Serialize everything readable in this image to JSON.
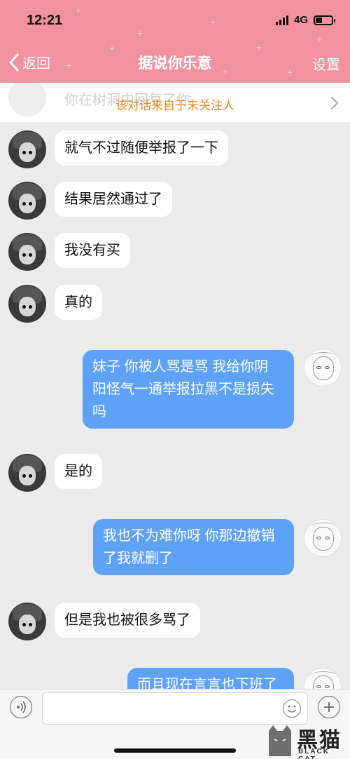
{
  "status_bar": {
    "time": "12:21",
    "network": "4G"
  },
  "nav": {
    "back_label": "返回",
    "title": "据说你乐意",
    "settings_label": "设置"
  },
  "notice": {
    "text": "该对话来自于未关注人",
    "ghost_text": "你在树洞中回复了你"
  },
  "messages": [
    {
      "side": "left",
      "text": "就气不过随便举报了一下"
    },
    {
      "side": "left",
      "text": "结果居然通过了"
    },
    {
      "side": "left",
      "text": "我没有买"
    },
    {
      "side": "left",
      "text": "真的"
    },
    {
      "side": "right",
      "lines": [
        "妹子 你被人骂是骂 我给你阴",
        "阳怪气一通举报拉黑不是损失",
        "吗"
      ]
    },
    {
      "side": "left",
      "text": "是的"
    },
    {
      "side": "right",
      "lines": [
        "我也不为难你呀 你那边撤销",
        "了我就删了"
      ]
    },
    {
      "side": "left",
      "text": "但是我也被很多骂了"
    },
    {
      "side": "right",
      "lines": [
        "而且现在言言也下班了"
      ]
    }
  ],
  "input": {
    "placeholder": ""
  },
  "watermark": {
    "text": "黑猫",
    "sub": "BLACK CAT"
  },
  "colors": {
    "header": "#f2929f",
    "outgoing_bubble": "#5ea2f7",
    "notice_text": "#e98b26",
    "background": "#ebebeb"
  }
}
